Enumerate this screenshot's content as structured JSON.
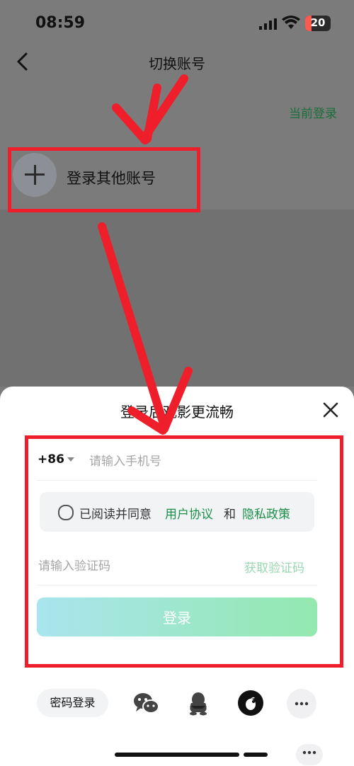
{
  "status_bar": {
    "time": "08:59",
    "battery": "20"
  },
  "header": {
    "title": "切换账号"
  },
  "current_login_label": "当前登录",
  "add_account": {
    "label": "登录其他账号"
  },
  "sheet": {
    "title": "登录后观影更流畅",
    "country_code": "+86",
    "phone_placeholder": "请输入手机号",
    "agree_prefix": "已阅读并同意",
    "user_agreement": "用户协议",
    "and": "和",
    "privacy_policy": "隐私政策",
    "code_placeholder": "请输入验证码",
    "get_code": "获取验证码",
    "login_button": "登录",
    "password_login": "密码登录"
  },
  "colors": {
    "accent_green": "#1b8f4a",
    "annotation_red": "#ee1f2b",
    "battery_red": "#ff5a4f"
  },
  "icons": [
    "back-icon",
    "plus-icon",
    "close-icon",
    "wechat-icon",
    "qq-icon",
    "apple-icon",
    "more-icon"
  ]
}
